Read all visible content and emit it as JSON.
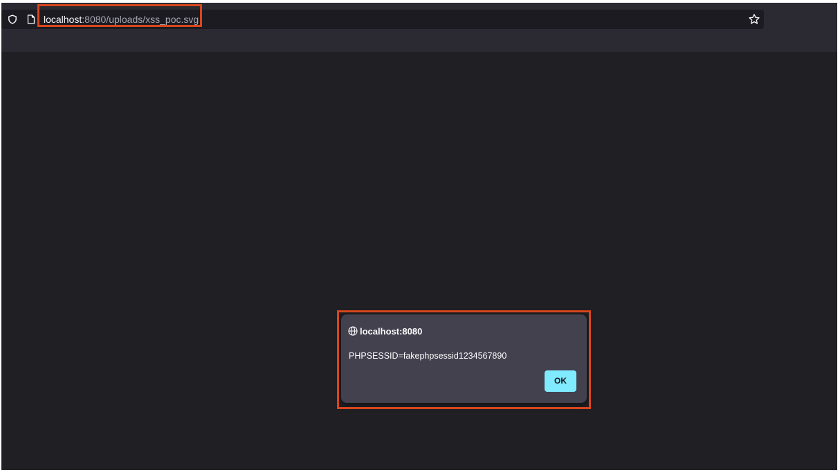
{
  "browser": {
    "url_host": "localhost",
    "url_rest": ":8080/uploads/xss_poc.svg",
    "icons": {
      "site_info": "shield-icon",
      "page": "page-icon",
      "bookmark": "star-icon"
    }
  },
  "alert_dialog": {
    "origin": "localhost:8080",
    "origin_icon": "globe-icon",
    "message": "PHPSESSID=fakephpsessid1234567890",
    "ok_label": "OK"
  },
  "colors": {
    "highlight": "#d9461c",
    "page_background": "#201f24",
    "toolbar": "#2b2a33",
    "urlbar": "#1c1b22",
    "dialog": "#42414d",
    "ok_button": "#80ebff"
  }
}
